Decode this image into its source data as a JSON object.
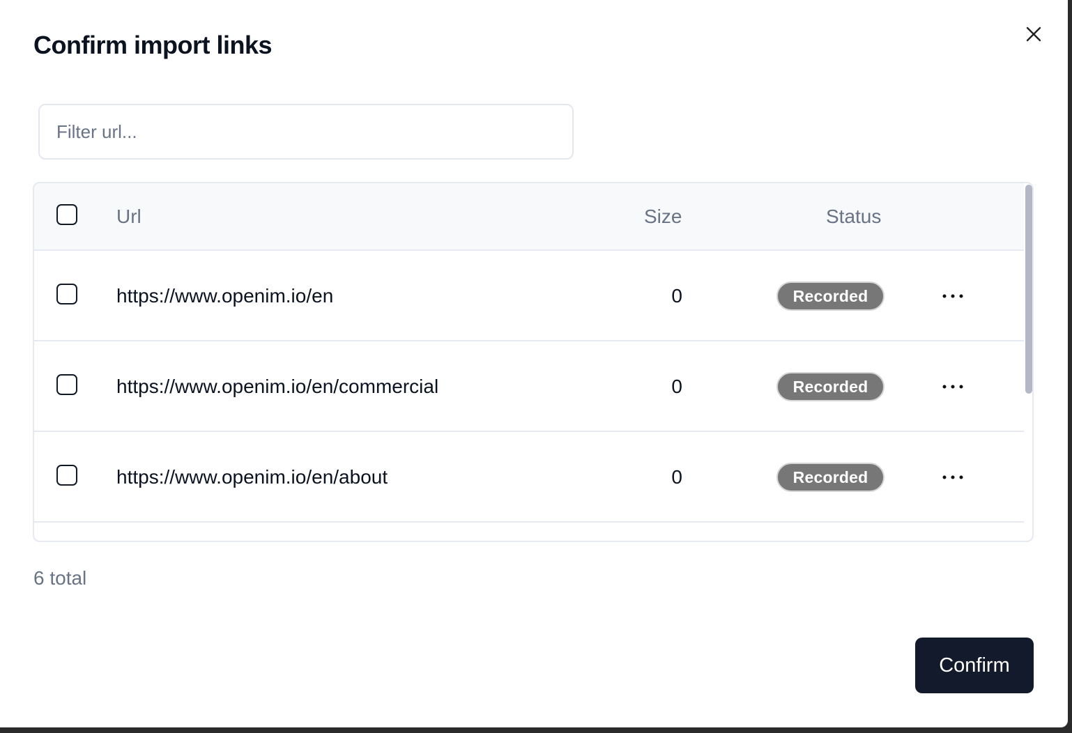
{
  "dialog": {
    "title": "Confirm import links",
    "close_icon": "close-icon"
  },
  "filter": {
    "placeholder": "Filter url...",
    "value": ""
  },
  "table": {
    "columns": {
      "url": "Url",
      "size": "Size",
      "status": "Status"
    },
    "rows": [
      {
        "url": "https://www.openim.io/en",
        "size": "0",
        "status": "Recorded",
        "checked": false
      },
      {
        "url": "https://www.openim.io/en/commercial",
        "size": "0",
        "status": "Recorded",
        "checked": false
      },
      {
        "url": "https://www.openim.io/en/about",
        "size": "0",
        "status": "Recorded",
        "checked": false
      }
    ],
    "row_action_icon": "more-horizontal-icon",
    "status_color": "#777777"
  },
  "footer": {
    "total_label": "6 total",
    "confirm_label": "Confirm"
  },
  "colors": {
    "primary_button": "#131a2b",
    "muted_text": "#687385",
    "border": "#e6e9ef"
  }
}
